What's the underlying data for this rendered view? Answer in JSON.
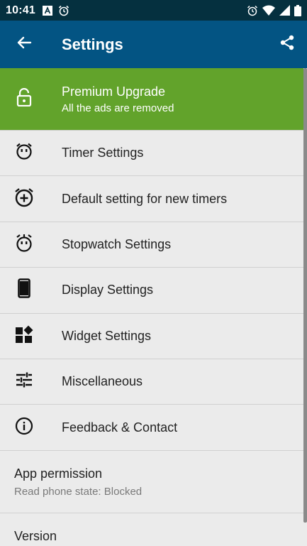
{
  "status_bar": {
    "time": "10:41",
    "left_icons": [
      "a-box-icon",
      "alarm-clock-icon"
    ],
    "right_icons": [
      "alarm-icon",
      "wifi-icon",
      "signal-icon",
      "battery-icon"
    ]
  },
  "app_bar": {
    "title": "Settings",
    "back_icon": "arrow-left-icon",
    "share_icon": "share-icon"
  },
  "premium": {
    "title": "Premium Upgrade",
    "subtitle": "All the ads are removed",
    "icon": "lock-open-icon",
    "color": "#62a32b"
  },
  "menu": {
    "items": [
      {
        "label": "Timer Settings",
        "icon": "timer-face-icon"
      },
      {
        "label": "Default setting for new timers",
        "icon": "alarm-add-icon"
      },
      {
        "label": "Stopwatch Settings",
        "icon": "stopwatch-face-icon"
      },
      {
        "label": "Display Settings",
        "icon": "phone-icon"
      },
      {
        "label": "Widget Settings",
        "icon": "widgets-icon"
      },
      {
        "label": "Miscellaneous",
        "icon": "tune-icon"
      },
      {
        "label": "Feedback & Contact",
        "icon": "info-icon"
      }
    ]
  },
  "permission": {
    "title": "App permission",
    "subtitle": "Read phone state: Blocked"
  },
  "version": {
    "title": "Version"
  },
  "colors": {
    "status_bar": "#05303f",
    "app_bar": "#035483",
    "background": "#ebebeb"
  }
}
